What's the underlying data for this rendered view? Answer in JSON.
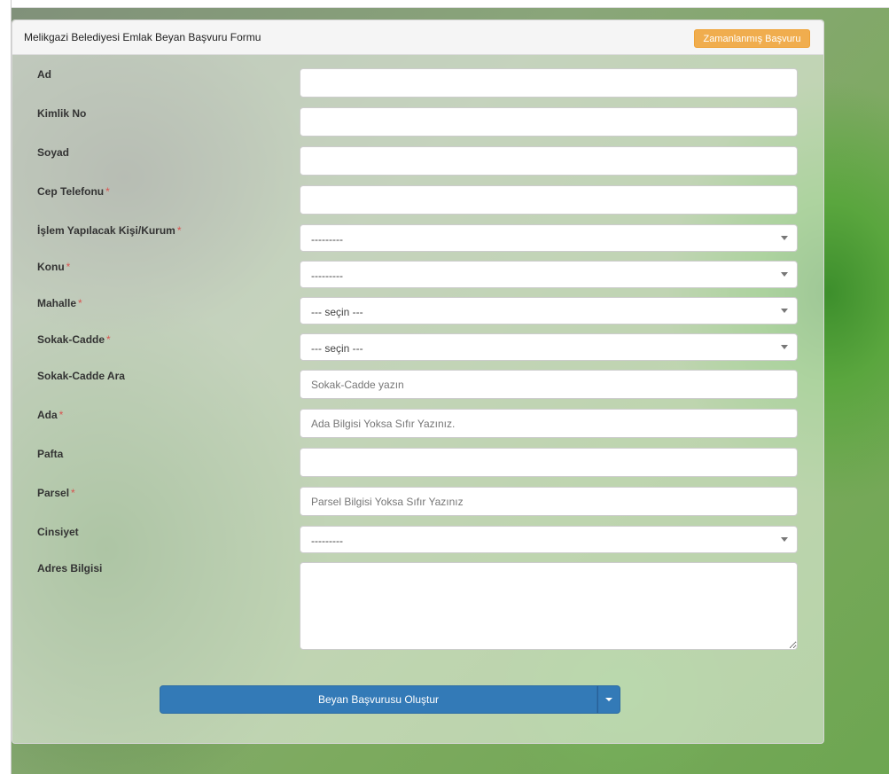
{
  "form": {
    "title": "Melikgazi Belediyesi Emlak Beyan Başvuru Formu",
    "scheduled_button": "Zamanlanmış Başvuru",
    "required_mark": "*",
    "fields": {
      "ad": {
        "label": "Ad",
        "value": "",
        "placeholder": ""
      },
      "kimlik_no": {
        "label": "Kimlik No",
        "value": "",
        "placeholder": ""
      },
      "soyad": {
        "label": "Soyad",
        "value": "",
        "placeholder": ""
      },
      "cep_telefonu": {
        "label": "Cep Telefonu",
        "value": "",
        "placeholder": ""
      },
      "islem_kisi": {
        "label": "İşlem Yapılacak Kişi/Kurum",
        "selected": "---------"
      },
      "konu": {
        "label": "Konu",
        "selected": "---------"
      },
      "mahalle": {
        "label": "Mahalle",
        "selected": "--- seçin ---"
      },
      "sokak_cadde": {
        "label": "Sokak-Cadde",
        "selected": "--- seçin ---"
      },
      "sokak_cadde_ara": {
        "label": "Sokak-Cadde Ara",
        "value": "",
        "placeholder": "Sokak-Cadde yazın"
      },
      "ada": {
        "label": "Ada",
        "value": "",
        "placeholder": "Ada Bilgisi Yoksa Sıfır Yazınız."
      },
      "pafta": {
        "label": "Pafta",
        "value": "",
        "placeholder": ""
      },
      "parsel": {
        "label": "Parsel",
        "value": "",
        "placeholder": "Parsel Bilgisi Yoksa Sıfır Yazınız"
      },
      "cinsiyet": {
        "label": "Cinsiyet",
        "selected": "---------"
      },
      "adres_bilgisi": {
        "label": "Adres Bilgisi",
        "value": ""
      }
    },
    "submit_label": "Beyan Başvurusu Oluştur"
  },
  "colors": {
    "primary": "#337ab7",
    "warning": "#f0ad4e",
    "required": "#d9534f"
  }
}
